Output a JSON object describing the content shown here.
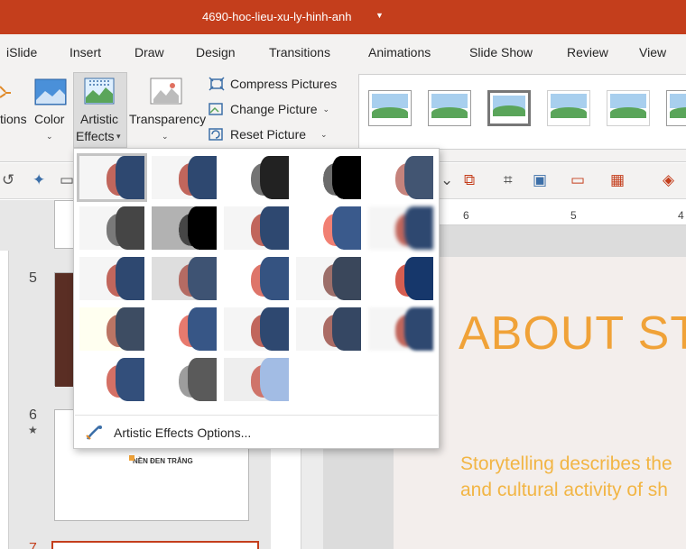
{
  "window": {
    "title": "4690-hoc-lieu-xu-ly-hinh-anh"
  },
  "tabs": [
    "iSlide",
    "Insert",
    "Draw",
    "Design",
    "Transitions",
    "Animations",
    "Slide Show",
    "Review",
    "View"
  ],
  "ribbon": {
    "corrections_partial": "tions",
    "color_label": "Color",
    "artistic_label_1": "Artistic",
    "artistic_label_2": "Effects",
    "transparency_label": "Transparency",
    "compress_label": "Compress Pictures",
    "change_label": "Change Picture",
    "reset_label": "Reset Picture"
  },
  "ruler": {
    "marks": [
      "6",
      "5",
      "4"
    ]
  },
  "slides": {
    "numbers": [
      "5",
      "6",
      "7"
    ],
    "star": "★",
    "thumb6_text": "NỀN ĐEN TRẮNG"
  },
  "slide": {
    "title": "ABOUT ST",
    "body_line1": "Storytelling describes the",
    "body_line2": "and cultural activity of sh"
  },
  "gallery": {
    "effects_count": 23,
    "selected_index": 0,
    "option_label": "Artistic Effects Options..."
  },
  "colors": {
    "titlebar": "#c43e1c",
    "accent_title": "#f0a238",
    "body_text": "#f2b544"
  }
}
